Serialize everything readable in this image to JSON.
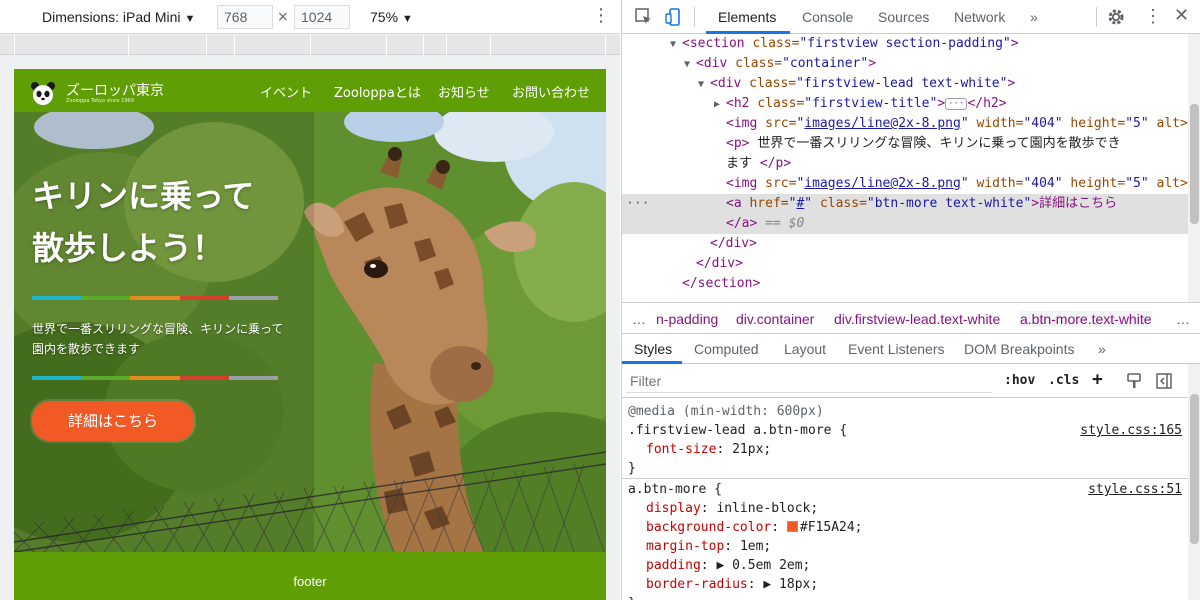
{
  "device_toolbar": {
    "dimensions_label": "Dimensions: iPad Mini",
    "width": "768",
    "times": "×",
    "height": "1024",
    "zoom": "75%"
  },
  "site": {
    "logo_title": "ズーロッパ東京",
    "logo_subtitle": "Zooloppa Tokyo since 1969",
    "nav": [
      "イベント",
      "Zooloppaとは",
      "お知らせ",
      "お問い合わせ"
    ],
    "hero_title_line1": "キリンに乗って",
    "hero_title_line2": "散歩しよう！",
    "hero_text": "世界で一番スリリングな冒険、キリンに乗って園内を散歩できます",
    "button_label": "詳細はこちら",
    "footer": "footer",
    "line_colors": [
      "#1fb6c9",
      "#5bab2b",
      "#e38b1c",
      "#d6412b",
      "#9aa0a6"
    ],
    "button_color": "#F15A24",
    "brand_green": "#5f9e04"
  },
  "devtools": {
    "tabs": [
      "Elements",
      "Console",
      "Sources",
      "Network",
      "»"
    ],
    "active_tab": "Elements",
    "dom": {
      "l1_tag": "<section",
      "l1_attr": "class=",
      "l1_val": "\"firstview section-padding\"",
      "l1_end": ">",
      "l2_tag": "<div",
      "l2_attr": "class=",
      "l2_val": "\"container\"",
      "l2_end": ">",
      "l3_tag": "<div",
      "l3_attr": "class=",
      "l3_val": "\"firstview-lead text-white\"",
      "l3_end": ">",
      "l4_tag": "<h2",
      "l4_attr": "class=",
      "l4_val": "\"firstview-title\"",
      "l4_gt": ">",
      "l4_ell": "···",
      "l4_close": "</h2>",
      "l5_tag": "<img",
      "l5_src_attr": "src=",
      "l5_src": "images/line@2x-8.png",
      "l5_width_attr": "width=",
      "l5_width": "\"404\"",
      "l5_height_attr": "height=",
      "l5_height": "\"5\"",
      "l5_alt": "alt>",
      "l6_tag": "<p>",
      "l6_text": "世界で一番スリリングな冒険、キリンに乗って園内を散歩でき",
      "l7_text": "ます",
      "l7_close": "</p>",
      "l8_tag": "<img",
      "l8_src_attr": "src=",
      "l8_src": "images/line@2x-8.png",
      "l8_width_attr": "width=",
      "l8_width": "\"404\"",
      "l8_height_attr": "height=",
      "l8_height": "\"5\"",
      "l8_alt": "alt>",
      "l9_gutter": "···",
      "l9_tag": "<a",
      "l9_href_attr": "href=",
      "l9_href": "#",
      "l9_class_attr": "class=",
      "l9_class": "\"btn-more text-white\"",
      "l9_text": ">詳細はこちら",
      "l10_close": "</a>",
      "l10_eq": "== $0",
      "l11": "</div>",
      "l12": "</div>",
      "l13": "</section>"
    },
    "breadcrumbs": [
      "…",
      "n-padding",
      "div.container",
      "div.firstview-lead.text-white",
      "a.btn-more.text-white",
      "…"
    ],
    "subtabs": [
      "Styles",
      "Computed",
      "Layout",
      "Event Listeners",
      "DOM Breakpoints",
      "»"
    ],
    "active_subtab": "Styles",
    "filter_placeholder": "Filter",
    "filter_buttons": [
      ":hov",
      ".cls",
      "+"
    ],
    "rules": [
      {
        "media": "@media (min-width: 600px)",
        "selector": ".firstview-lead a.btn-more {",
        "source": "style.css:165",
        "props": [
          {
            "name": "font-size",
            "value": "21px;"
          }
        ]
      },
      {
        "selector": "a.btn-more {",
        "source": "style.css:51",
        "props": [
          {
            "name": "display",
            "value": "inline-block;"
          },
          {
            "name": "background-color",
            "value": "#F15A24;"
          },
          {
            "name": "margin-top",
            "value": "1em;"
          },
          {
            "name": "padding",
            "value": "▶ 0.5em 2em;"
          },
          {
            "name": "border-radius",
            "value": "▶ 18px;"
          }
        ]
      }
    ],
    "close_brace": "}"
  }
}
